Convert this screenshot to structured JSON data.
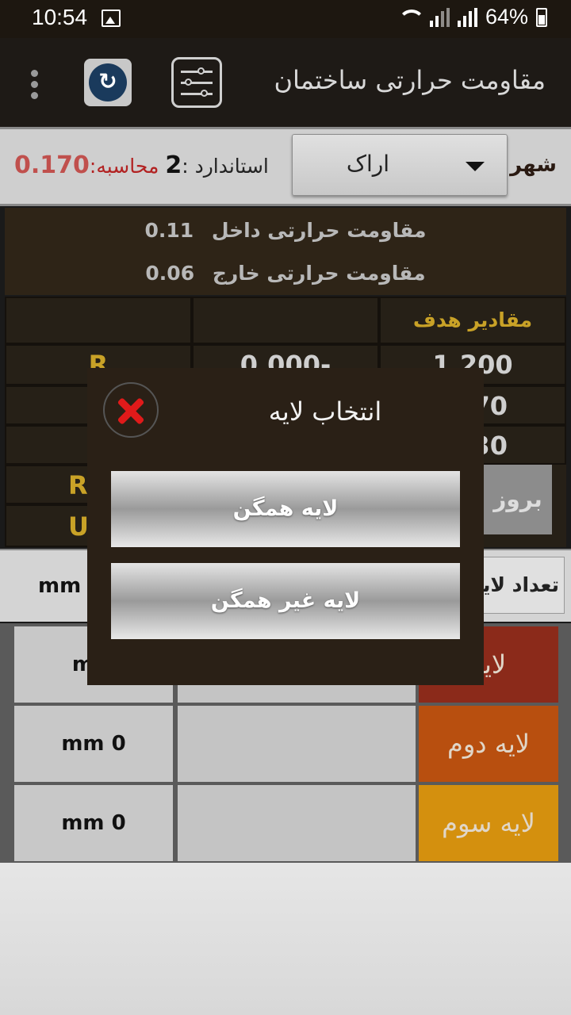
{
  "status_bar": {
    "time": "10:54",
    "battery": "64%"
  },
  "app_bar": {
    "title": "مقاومت حرارتی ساختمان"
  },
  "city_row": {
    "city_label": "شهر",
    "city_value": "اراک",
    "standard_label": "استاندارد :",
    "standard_value": "2",
    "calc_label": "محاسبه:",
    "calc_value": "0.170"
  },
  "resistance": {
    "inner_label": "مقاومت حرارتی داخل",
    "inner_value": "0.11",
    "outer_label": "مقاومت حرارتی خارج",
    "outer_value": "0.06"
  },
  "target_table": {
    "header": "مقادیر هدف",
    "row1_value": "1.200",
    "row1_calc": "0.000-",
    "row1_unit": "R",
    "row2_value": "70",
    "row3_value": "30",
    "update_label": "بروز",
    "row4_unit": "R",
    "row5_unit": "U"
  },
  "layer_count": {
    "mm_label": "mm",
    "count_label": "تعداد لایه"
  },
  "layers": [
    {
      "name": "لایه",
      "mm": "mm",
      "color": "#8b2a1a"
    },
    {
      "name": "لایه دوم",
      "mm": "mm 0",
      "color": "#b84f0f"
    },
    {
      "name": "لایه سوم",
      "mm": "mm 0",
      "color": "#d4900e"
    }
  ],
  "dialog": {
    "title": "انتخاب لایه",
    "option_homogeneous": "لایه همگن",
    "option_heterogeneous": "لایه غیر همگن"
  },
  "colors": {
    "calc_red": "#c0504d",
    "gold": "#c9a227",
    "close_red": "#e01a1a"
  }
}
